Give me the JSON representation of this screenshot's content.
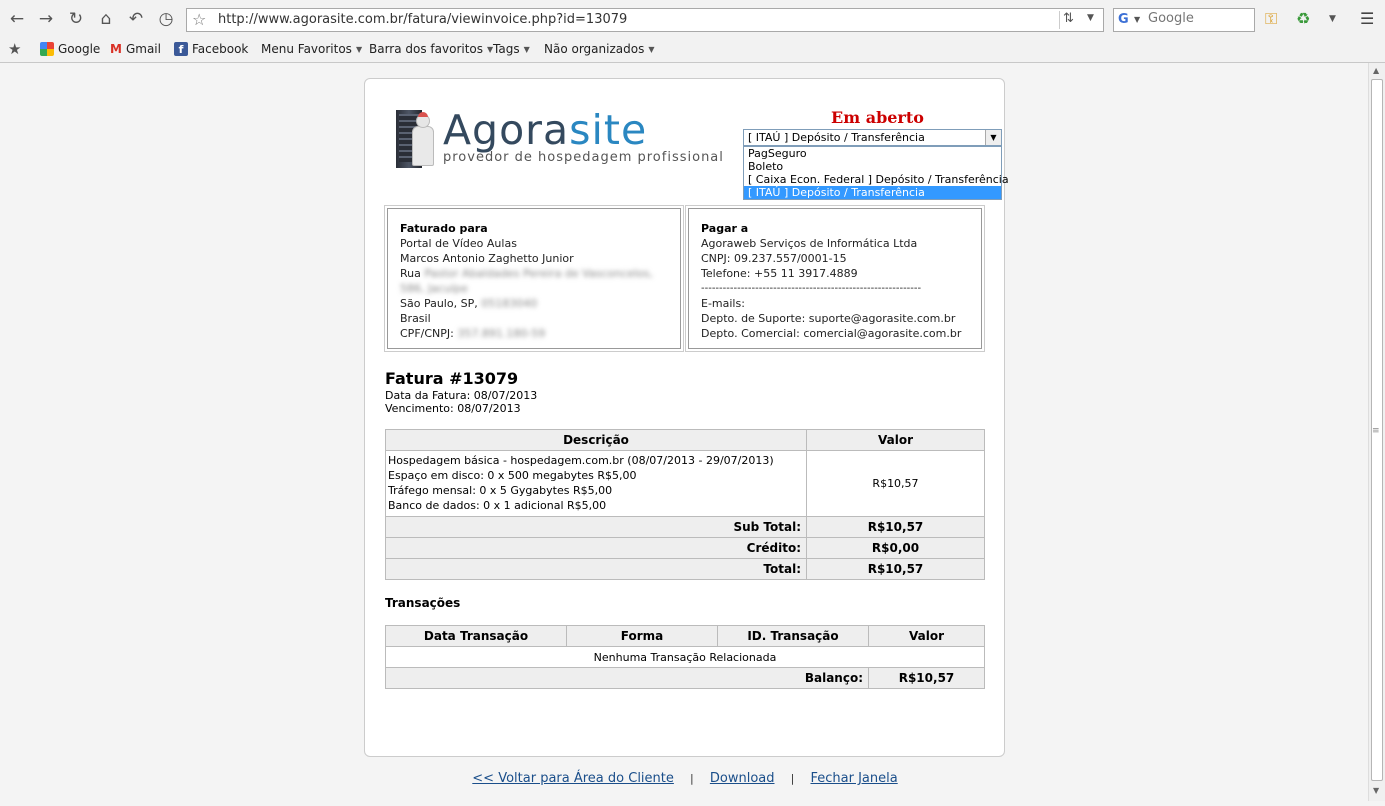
{
  "browser": {
    "url": "http://www.agorasite.com.br/fatura/viewinvoice.php?id=13079",
    "search_placeholder": "Google",
    "bookmarks": [
      {
        "label": "Google",
        "icon": "google-icon"
      },
      {
        "label": "Gmail",
        "icon": "gmail-icon"
      },
      {
        "label": "Facebook",
        "icon": "facebook-icon"
      },
      {
        "label": "Menu Favoritos"
      },
      {
        "label": "Barra dos favoritos"
      },
      {
        "label": "Tags"
      },
      {
        "label": "Não organizados"
      }
    ]
  },
  "logo": {
    "name_part1": "Agora",
    "name_part2": "site",
    "tagline": "provedor de hospedagem profissional"
  },
  "status": "Em aberto",
  "payment": {
    "selected": "[ ITAÚ ] Depósito / Transferência",
    "options": [
      "PagSeguro",
      "Boleto",
      "[ Caixa Econ. Federal ] Depósito / Transferência",
      "[ ITAÚ ] Depósito / Transferência"
    ]
  },
  "billed_to": {
    "heading": "Faturado para",
    "company": "Portal de Vídeo Aulas",
    "name": "Marcos Antonio Zaghetto Junior",
    "street_prefix": "Rua",
    "street_blurred": "Pastor Abaldades Pereira de Vasconcelos, 586, Jacuípe",
    "city": "São Paulo, SP,",
    "zip_blurred": "05183040",
    "country": "Brasil",
    "doc_label": "CPF/CNPJ:",
    "doc_blurred": "357.891.180-59"
  },
  "pay_to": {
    "heading": "Pagar a",
    "company": "Agoraweb Serviços de Informática Ltda",
    "cnpj": "CNPJ: 09.237.557/0001-15",
    "phone": "Telefone: +55 11 3917.4889",
    "divider": "-------------------------------------------------------------",
    "emails_label": "E-mails:",
    "support": "Depto. de Suporte: suporte@agorasite.com.br",
    "commercial": "Depto. Comercial: comercial@agorasite.com.br"
  },
  "invoice": {
    "title": "Fatura #13079",
    "date": "Data da Fatura: 08/07/2013",
    "due": "Vencimento: 08/07/2013"
  },
  "items_table": {
    "col_desc": "Descrição",
    "col_value": "Valor",
    "lines": [
      "Hospedagem básica - hospedagem.com.br (08/07/2013 - 29/07/2013)",
      "Espaço em disco: 0 x 500 megabytes R$5,00",
      "Tráfego mensal: 0 x 5 Gygabytes R$5,00",
      "Banco de dados: 0 x 1 adicional R$5,00"
    ],
    "value": "R$10,57",
    "subtotal_label": "Sub Total:",
    "subtotal": "R$10,57",
    "credit_label": "Crédito:",
    "credit": "R$0,00",
    "total_label": "Total:",
    "total": "R$10,57"
  },
  "transactions": {
    "title": "Transações",
    "cols": [
      "Data Transação",
      "Forma",
      "ID. Transação",
      "Valor"
    ],
    "empty": "Nenhuma Transação Relacionada",
    "balance_label": "Balanço:",
    "balance": "R$10,57"
  },
  "footer": {
    "back": "<< Voltar para Área do Cliente",
    "sep": "|",
    "download": "Download",
    "close": "Fechar Janela"
  }
}
